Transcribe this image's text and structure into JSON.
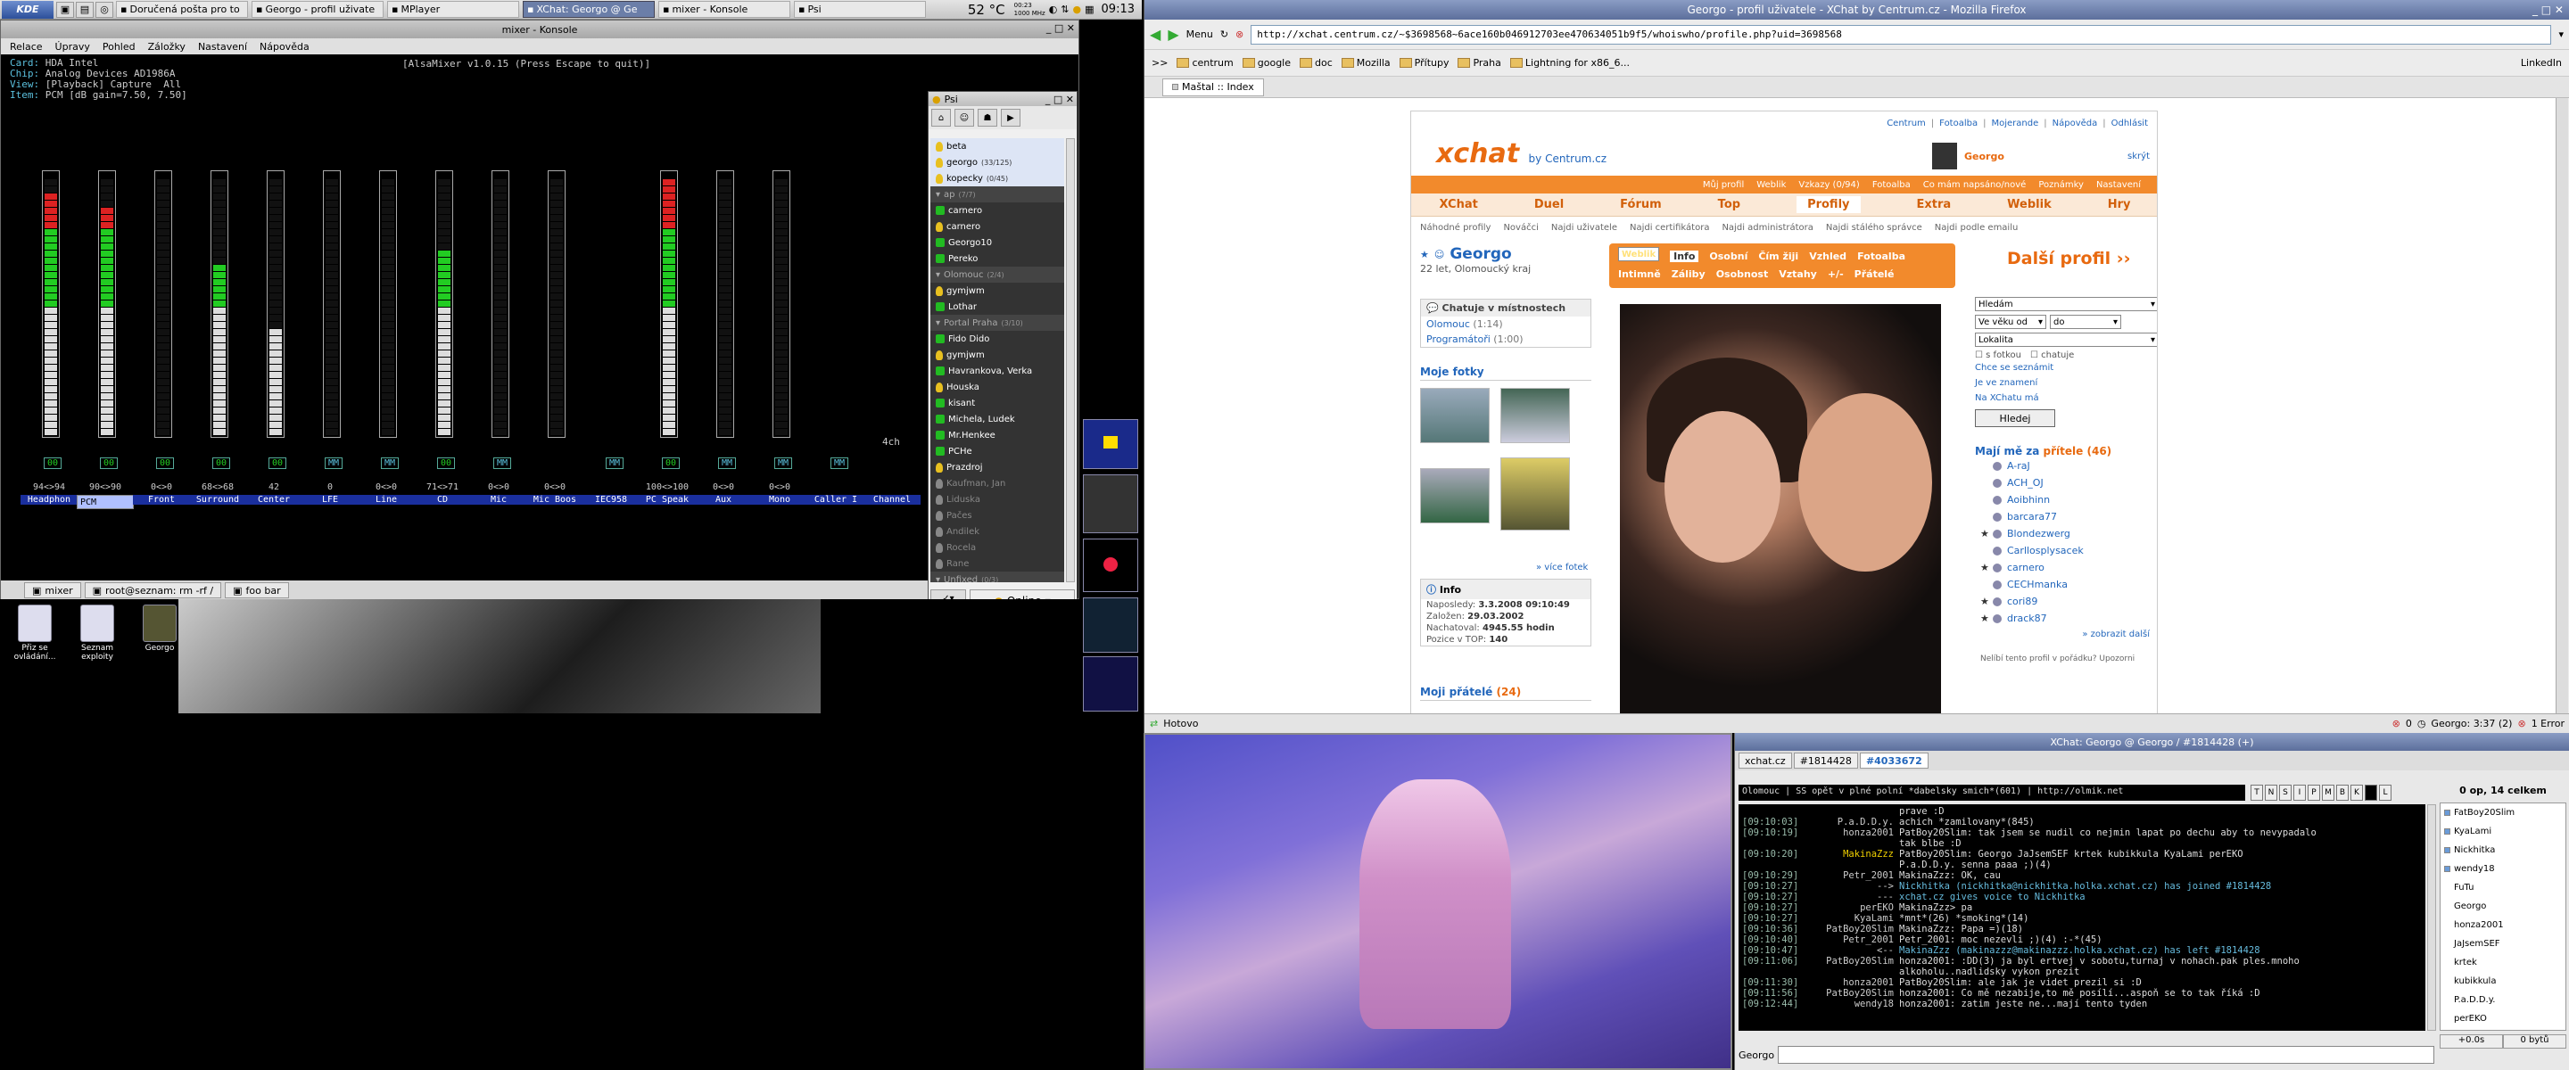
{
  "taskbar": {
    "kmenu": "KDE",
    "tasks": [
      {
        "label": "Doručená pošta pro to",
        "active": false
      },
      {
        "label": "Georgo - profil uživate",
        "active": false
      },
      {
        "label": "MPlayer",
        "active": false
      },
      {
        "label": "XChat: Georgo @ Ge",
        "active": true
      },
      {
        "label": "mixer - Konsole",
        "active": false
      },
      {
        "label": "Psi",
        "active": false
      }
    ],
    "temp": "52 °C",
    "cpu1": "00:23",
    "cpu2": "1000 MHz",
    "clock": "09:13"
  },
  "firefox": {
    "title": "Georgo - profil uživatele - XChat by Centrum.cz - Mozilla Firefox",
    "menu": "Menu",
    "url": "http://xchat.centrum.cz/~$3698568~6ace160b046912703ee470634051b9f5/whoiswho/profile.php?uid=3698568",
    "bookmarks": [
      ">>",
      "centrum",
      "google",
      "doc",
      "Mozilla",
      "Přítupy",
      "Praha",
      "Lightning for x86_6..."
    ],
    "linked": "LinkedIn",
    "tab": "Maštal :: Index",
    "status": "Hotovo",
    "status_right": "Georgo: 3:37 (2)",
    "errors": "1 Error",
    "errcount": "0"
  },
  "site": {
    "toplinks": [
      "Centrum",
      "Fotoalba",
      "Mojerande",
      "Nápověda",
      "Odhlásit"
    ],
    "logo": "xchat",
    "logo_by": "by Centrum.cz",
    "user": "Georgo",
    "user_hide": "skrýt",
    "orange_links": [
      "Můj profil",
      "Weblik",
      "Vzkazy (0/94)",
      "Fotoalba",
      "Co mám napsáno/nové",
      "Poznámky",
      "Nastavení"
    ],
    "nav": [
      "XChat",
      "Duel",
      "Fórum",
      "Top",
      "Profily",
      "Extra",
      "Weblik",
      "Hry"
    ],
    "subnav": [
      "Náhodné profily",
      "Nováčci",
      "Najdi uživatele",
      "Najdi certifikátora",
      "Najdi administrátora",
      "Najdi stálého správce",
      "Najdi podle emailu"
    ],
    "profile_name": "Georgo",
    "profile_info": "22 let, Olomoucký kraj",
    "ptabs_row1": [
      "Weblik",
      "Info",
      "Osobní",
      "Čím žiji",
      "Vzhled",
      "Fotoalba"
    ],
    "ptabs_row2": [
      "Intimně",
      "Záliby",
      "Osobnost",
      "Vztahy",
      "+/-",
      "Přátelé"
    ],
    "dalsi": "Další profil ››",
    "chatuje_title": "Chatuje v místnostech",
    "rooms": [
      {
        "name": "Olomouc",
        "time": "(1:14)"
      },
      {
        "name": "Programátoři",
        "time": "(1:00)"
      }
    ],
    "fotky_title": "Moje fotky",
    "vice_fotek": "» více fotek",
    "info_title": "Info",
    "info_rows": [
      {
        "k": "Naposledy:",
        "v": "3.3.2008 09:10:49"
      },
      {
        "k": "Založen:",
        "v": "29.03.2002"
      },
      {
        "k": "Nachatoval:",
        "v": "4945.55 hodin"
      },
      {
        "k": "Pozice v TOP:",
        "v": "140"
      }
    ],
    "pratele_title": "Moji přátelé",
    "pratele_count": "(24)",
    "search": {
      "hledam": "Hledám",
      "vek_od": "Ve věku od",
      "vek_do": "do",
      "lokalita": "Lokalita",
      "s_fotkou": "s fotkou",
      "chatuje": "chatuje",
      "btn": "Hledej"
    },
    "links": [
      "Chce se seznámit",
      "Je ve znamení",
      "Na XChatu má"
    ],
    "mameza_title": "Mají mě za",
    "mameza_word": "přítele",
    "mameza_count": "(46)",
    "friends": [
      "A-raJ",
      "ACH_OJ",
      "Aoibhinn",
      "barcara77",
      "Blondezwerg",
      "Carllosplysacek",
      "carnero",
      "CECHmanka",
      "cori89",
      "drack87"
    ],
    "zobrazit": "» zobrazit další",
    "report": "Nelíbí tento profil v pořádku? Upozorni"
  },
  "konsole": {
    "title": "mixer - Konsole",
    "menu": [
      "Relace",
      "Úpravy",
      "Pohled",
      "Záložky",
      "Nastavení",
      "Nápověda"
    ],
    "banner": "[AlsaMixer v1.0.15 (Press Escape to quit)]",
    "card_l": "Card:",
    "card": "HDA Intel",
    "chip_l": "Chip:",
    "chip": "Analog Devices AD1986A",
    "view_l": "View:",
    "view": "[Playback] Capture  All",
    "item_l": "Item:",
    "item": "PCM [dB gain=7.50, 7.50]",
    "ch4": "4ch",
    "channels": [
      {
        "name": "Headphon",
        "val": "94<>94",
        "level": 0.95,
        "mute": "00",
        "red": true
      },
      {
        "name": "PCM",
        "val": "90<>90",
        "level": 0.9,
        "mute": "00",
        "red": true,
        "sel": true
      },
      {
        "name": "Front",
        "val": "0<>0",
        "level": 0,
        "mute": "00"
      },
      {
        "name": "Surround",
        "val": "68<>68",
        "level": 0.68,
        "mute": "00"
      },
      {
        "name": "Center",
        "val": "42",
        "level": 0.42,
        "mute": "00"
      },
      {
        "name": "LFE",
        "val": "0",
        "level": 0,
        "mute": "MM"
      },
      {
        "name": "Line",
        "val": "0<>0",
        "level": 0,
        "mute": "MM"
      },
      {
        "name": "CD",
        "val": "71<>71",
        "level": 0.71,
        "mute": "00"
      },
      {
        "name": "Mic",
        "val": "0<>0",
        "level": 0,
        "mute": "MM"
      },
      {
        "name": "Mic Boos",
        "val": "0<>0",
        "level": 0,
        "mute": ""
      },
      {
        "name": "IEC958",
        "val": "",
        "level": -1,
        "mute": "MM"
      },
      {
        "name": "PC Speak",
        "val": "100<>100",
        "level": 1,
        "mute": "00",
        "red": true
      },
      {
        "name": "Aux",
        "val": "0<>0",
        "level": 0,
        "mute": "MM"
      },
      {
        "name": "Mono",
        "val": "0<>0",
        "level": 0,
        "mute": "MM"
      },
      {
        "name": "Caller I",
        "val": "",
        "level": -1,
        "mute": "MM"
      },
      {
        "name": "Channel",
        "val": "",
        "level": -1,
        "mute": ""
      }
    ],
    "tabs": [
      "mixer",
      "root@seznam: rm -rf /",
      "foo bar"
    ]
  },
  "psi": {
    "title": "Psi",
    "roster": [
      {
        "t": "acct",
        "n": "beta"
      },
      {
        "t": "acct",
        "n": "georgo",
        "x": "(33/125)"
      },
      {
        "t": "acct",
        "n": "kopecky",
        "x": "(0/45)"
      },
      {
        "t": "grp",
        "n": "ap",
        "x": "(7/7)"
      },
      {
        "t": "on",
        "n": "carnero"
      },
      {
        "t": "away",
        "n": "carnero"
      },
      {
        "t": "on",
        "n": "Georgo10"
      },
      {
        "t": "on",
        "n": "Pereko"
      },
      {
        "t": "grp",
        "n": "Olomouc",
        "x": "(2/4)"
      },
      {
        "t": "away",
        "n": "gymjwm"
      },
      {
        "t": "on",
        "n": "Lothar"
      },
      {
        "t": "grp",
        "n": "Portal Praha",
        "x": "(3/10)"
      },
      {
        "t": "on",
        "n": "Fido Dido"
      },
      {
        "t": "away",
        "n": "gymjwm"
      },
      {
        "t": "on",
        "n": "Havrankova, Verka"
      },
      {
        "t": "away",
        "n": "Houska"
      },
      {
        "t": "on",
        "n": "kisant"
      },
      {
        "t": "on",
        "n": "Michela, Ludek"
      },
      {
        "t": "on",
        "n": "Mr.Henkee"
      },
      {
        "t": "on",
        "n": "PCHe"
      },
      {
        "t": "away",
        "n": "Prazdroj"
      },
      {
        "t": "off",
        "n": "Kaufman, Jan"
      },
      {
        "t": "off",
        "n": "Liduska"
      },
      {
        "t": "off",
        "n": "Pačes"
      },
      {
        "t": "off",
        "n": "Andilek"
      },
      {
        "t": "off",
        "n": "Rocela"
      },
      {
        "t": "off",
        "n": "Rane"
      },
      {
        "t": "grp",
        "n": "Unfixed",
        "x": "(0/3)"
      }
    ],
    "status": "Online"
  },
  "desktop": {
    "icons": [
      "Přiz se ovládání...",
      "Seznam exploity",
      "Georgo"
    ]
  },
  "xchat": {
    "title": "XChat: Georgo @ Georgo / #1814428 (+)",
    "tabs": [
      "xchat.cz",
      "#1814428",
      "#4033672"
    ],
    "topic": "Olomouc | SS opět v plné polní *dabelsky smich*(601) | http://olmik.net",
    "modes": [
      "T",
      "N",
      "S",
      "I",
      "P",
      "M",
      "B",
      "K",
      "",
      "L"
    ],
    "users_head": "0 op, 14 celkem",
    "lines": [
      {
        "t": "",
        "n": "",
        "m": "prave :D",
        "c": ""
      },
      {
        "t": "[09:10:03]",
        "n": "P.a.D.D.y.",
        "m": "achich *zamilovany*(845)",
        "c": ""
      },
      {
        "t": "[09:10:19]",
        "n": "honza2001",
        "m": "PatBoy20Slim: tak jsem se nudil co nejmin lapat po dechu aby to nevypadalo",
        "c": ""
      },
      {
        "t": "",
        "n": "",
        "m": "tak blbe :D",
        "c": ""
      },
      {
        "t": "[09:10:20]",
        "n": "MakinaZzz",
        "m": "PatBoy20Slim: Georgo JaJsemSEF krtek kubikkula KyaLami perEKO",
        "c": "hl"
      },
      {
        "t": "",
        "n": "",
        "m": "P.a.D.D.y. senna paaa ;)(4)",
        "c": ""
      },
      {
        "t": "[09:10:29]",
        "n": "Petr_2001",
        "m": "MakinaZzz: OK, cau",
        "c": ""
      },
      {
        "t": "[09:10:27]",
        "n": "-->",
        "m": "Nickhitka (nickhitka@nickhitka.holka.xchat.cz) has joined #1814428",
        "c": "sysl"
      },
      {
        "t": "[09:10:27]",
        "n": "---",
        "m": "xchat.cz gives voice to Nickhitka",
        "c": "sysl"
      },
      {
        "t": "[09:10:27]",
        "n": "perEKO",
        "m": "MakinaZzz> pa",
        "c": ""
      },
      {
        "t": "[09:10:27]",
        "n": "KyaLami",
        "m": "*mnt*(26) *smoking*(14)",
        "c": ""
      },
      {
        "t": "[09:10:36]",
        "n": "PatBoy20Slim",
        "m": "MakinaZzz: Papa =)(18)",
        "c": ""
      },
      {
        "t": "[09:10:40]",
        "n": "Petr_2001",
        "m": "Petr_2001: moc nezevli ;)(4) :-*(45)",
        "c": ""
      },
      {
        "t": "[09:10:47]",
        "n": "<--",
        "m": "MakinaZzz (makinazzz@makinazzz.holka.xchat.cz) has left #1814428",
        "c": "sysl"
      },
      {
        "t": "[09:11:06]",
        "n": "PatBoy20Slim",
        "m": "honza2001: :DD(3) ja byl ertvej v sobotu,turnaj v nohach.pak ples.mnoho",
        "c": ""
      },
      {
        "t": "",
        "n": "",
        "m": "alkoholu..nadlidsky vykon prezit",
        "c": ""
      },
      {
        "t": "[09:11:30]",
        "n": "honza2001",
        "m": "PatBoy20Slim: ale jak je videt prezil si :D",
        "c": ""
      },
      {
        "t": "[09:11:56]",
        "n": "PatBoy20Slim",
        "m": "honza2001: Co mě nezabije,to mě posílí...aspoň se to tak říká :D",
        "c": ""
      },
      {
        "t": "[09:12:44]",
        "n": "wendy18",
        "m": "honza2001: zatim jeste ne...mají tento tyden",
        "c": ""
      }
    ],
    "users": [
      "FatBoy20Slim",
      "KyaLami",
      "Nickhitka",
      "wendy18",
      "FuTu",
      "Georgo",
      "honza2001",
      "JaJsemSEF",
      "krtek",
      "kubikkula",
      "P.a.D.D.y.",
      "perEKO"
    ],
    "lag": [
      "+0.0s",
      "0 bytů"
    ],
    "nick": "Georgo"
  }
}
